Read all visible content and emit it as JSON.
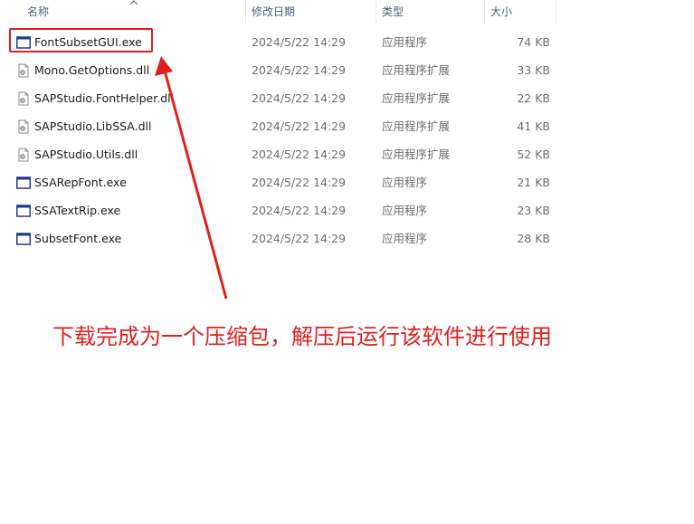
{
  "header": {
    "col_name": "名称",
    "col_modified": "修改日期",
    "col_type": "类型",
    "col_size": "大小"
  },
  "files": [
    {
      "name": "FontSubsetGUI.exe",
      "modified": "2024/5/22 14:29",
      "type": "应用程序",
      "size": "74 KB",
      "icon": "exe-window-icon"
    },
    {
      "name": "Mono.GetOptions.dll",
      "modified": "2024/5/22 14:29",
      "type": "应用程序扩展",
      "size": "33 KB",
      "icon": "dll-file-icon"
    },
    {
      "name": "SAPStudio.FontHelper.dll",
      "modified": "2024/5/22 14:29",
      "type": "应用程序扩展",
      "size": "22 KB",
      "icon": "dll-file-icon"
    },
    {
      "name": "SAPStudio.LibSSA.dll",
      "modified": "2024/5/22 14:29",
      "type": "应用程序扩展",
      "size": "41 KB",
      "icon": "dll-file-icon"
    },
    {
      "name": "SAPStudio.Utils.dll",
      "modified": "2024/5/22 14:29",
      "type": "应用程序扩展",
      "size": "52 KB",
      "icon": "dll-file-icon"
    },
    {
      "name": "SSARepFont.exe",
      "modified": "2024/5/22 14:29",
      "type": "应用程序",
      "size": "21 KB",
      "icon": "exe-window-icon"
    },
    {
      "name": "SSATextRip.exe",
      "modified": "2024/5/22 14:29",
      "type": "应用程序",
      "size": "23 KB",
      "icon": "exe-window-icon"
    },
    {
      "name": "SubsetFont.exe",
      "modified": "2024/5/22 14:29",
      "type": "应用程序",
      "size": "28 KB",
      "icon": "exe-window-icon"
    }
  ],
  "annotation": {
    "text": "下载完成为一个压缩包，解压后运行该软件进行使用",
    "color": "#e0201f"
  },
  "colors": {
    "highlight": "#e02020",
    "exe_icon": "#1f3a93",
    "header_text": "#4c607a"
  }
}
